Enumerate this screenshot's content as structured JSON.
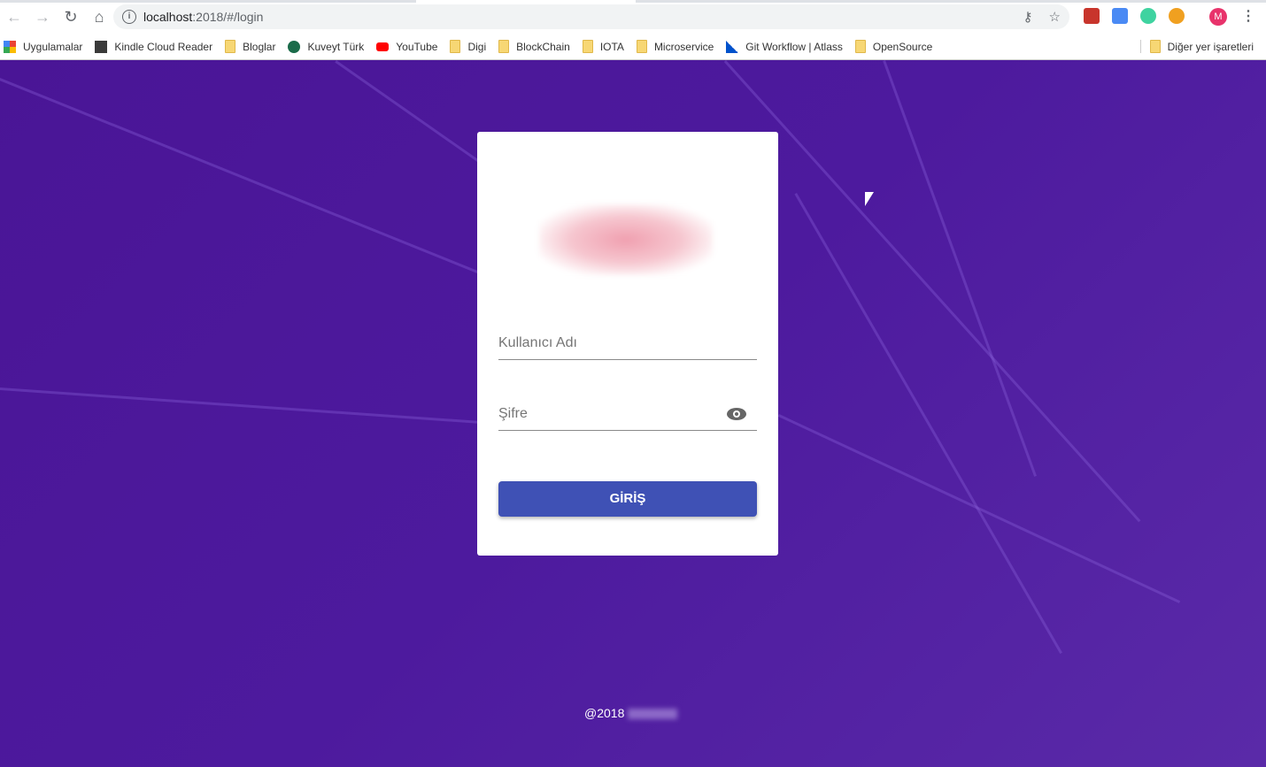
{
  "browser": {
    "url_host": "localhost",
    "url_path": ":2018/#/login",
    "avatar_letter": "M",
    "bookmarks": [
      {
        "label": "Uygulamalar",
        "icon": "apps-grid-icon"
      },
      {
        "label": "Kindle Cloud Reader",
        "icon": "kindle-icon"
      },
      {
        "label": "Bloglar",
        "icon": "folder-icon"
      },
      {
        "label": "Kuveyt Türk",
        "icon": "kuveyt-turk-icon"
      },
      {
        "label": "YouTube",
        "icon": "youtube-icon"
      },
      {
        "label": "Digi",
        "icon": "folder-icon"
      },
      {
        "label": "BlockChain",
        "icon": "folder-icon"
      },
      {
        "label": "IOTA",
        "icon": "folder-icon"
      },
      {
        "label": "Microservice",
        "icon": "folder-icon"
      },
      {
        "label": "Git Workflow | Atlass",
        "icon": "atlassian-icon"
      },
      {
        "label": "OpenSource",
        "icon": "folder-icon"
      }
    ],
    "other_bookmarks": "Diğer yer işaretleri"
  },
  "login": {
    "username_placeholder": "Kullanıcı Adı",
    "password_placeholder": "Şifre",
    "submit_label": "GİRİŞ"
  },
  "footer": {
    "text": "@2018"
  },
  "colors": {
    "background": "#4d1a9e",
    "button": "#3f51b5"
  }
}
